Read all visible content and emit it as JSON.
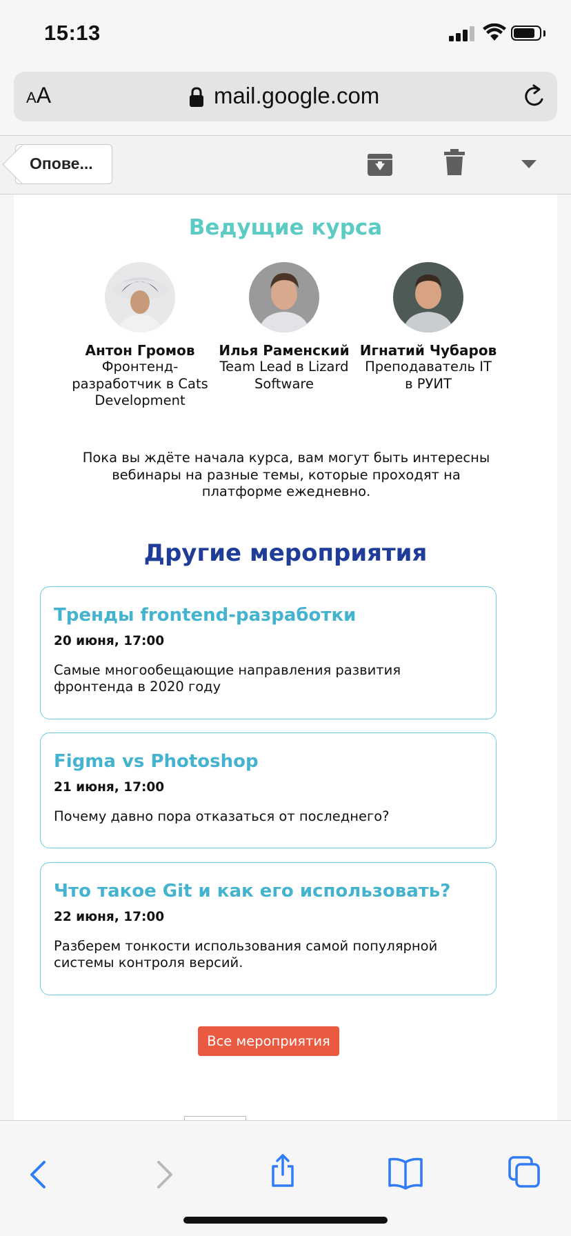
{
  "status_bar": {
    "time": "15:13"
  },
  "browser": {
    "aa_small": "A",
    "aa_big": "A",
    "url": "mail.google.com"
  },
  "mail_toolbar": {
    "back_label": "Опове..."
  },
  "email": {
    "hosts_title": "Ведущие курса",
    "speakers": [
      {
        "name": "Антон Громов",
        "role": "Фронтенд-разработчик в Cats Development"
      },
      {
        "name": "Илья Раменский",
        "role": "Team Lead в Lizard Software"
      },
      {
        "name": "Игнатий Чубаров",
        "role": "Преподаватель IT в РУИТ"
      }
    ],
    "intro_text": "Пока вы ждёте начала курса, вам могут быть интересны вебинары на разные темы, которые проходят на платформе ежедневно.",
    "events_title": "Другие мероприятия",
    "events": [
      {
        "title": "Тренды frontend-разработки",
        "date": "20 июня, 17:00",
        "description": "Самые многообещающие направления развития фронтенда в 2020 году"
      },
      {
        "title": "Figma vs Photoshop",
        "date": "21 июня, 17:00",
        "description": "Почему давно пора отказаться от последнего?"
      },
      {
        "title": "Что такое Git и как его использовать?",
        "date": "22 июня, 17:00",
        "description": "Разберем тонкости использования самой популярной системы контроля версий."
      }
    ],
    "all_events_label": "Все мероприятия"
  },
  "colors": {
    "hosts_title": "#5ccbc4",
    "events_title": "#1f3c98",
    "event_title": "#44b3cf",
    "card_border": "#6ccbe0",
    "cta_button": "#ea5a41",
    "safari_blue": "#2f7cf6"
  },
  "icons": [
    "lock-icon",
    "reload-icon",
    "archive-icon",
    "trash-icon",
    "chevron-down-icon",
    "back-arrow-icon",
    "forward-arrow-icon",
    "share-icon",
    "bookmarks-icon",
    "tabs-icon"
  ]
}
